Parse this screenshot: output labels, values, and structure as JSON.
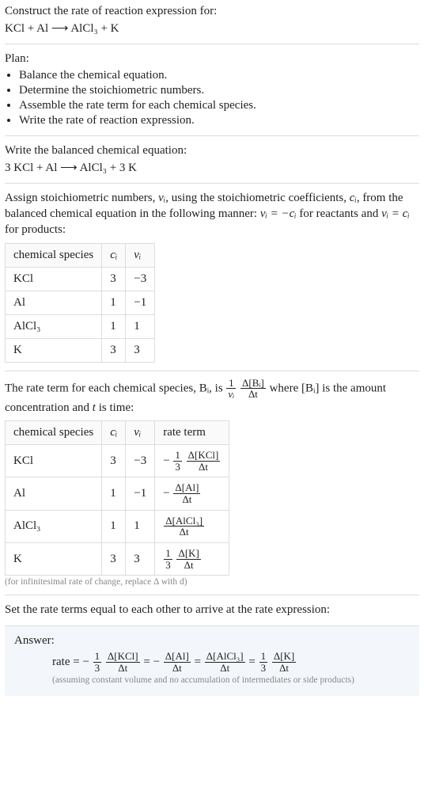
{
  "prompt": {
    "line1": "Construct the rate of reaction expression for:",
    "eq_unbalanced": "KCl + Al ⟶ AlCl₃ + K"
  },
  "plan": {
    "heading": "Plan:",
    "items": [
      "Balance the chemical equation.",
      "Determine the stoichiometric numbers.",
      "Assemble the rate term for each chemical species.",
      "Write the rate of reaction expression."
    ]
  },
  "balanced": {
    "heading": "Write the balanced chemical equation:",
    "eq": "3 KCl + Al ⟶ AlCl₃ + 3 K"
  },
  "stoich": {
    "intro_a": "Assign stoichiometric numbers, ",
    "sym_nu_i": "νᵢ",
    "intro_b": ", using the stoichiometric coefficients, ",
    "sym_c_i": "cᵢ",
    "intro_c": ", from the balanced chemical equation in the following manner: ",
    "rule_react": "νᵢ = −cᵢ",
    "intro_d": " for reactants and ",
    "rule_prod": "νᵢ = cᵢ",
    "intro_e": " for products:",
    "table": {
      "headers": [
        "chemical species",
        "cᵢ",
        "νᵢ"
      ],
      "rows": [
        {
          "species": "KCl",
          "c": "3",
          "nu": "−3"
        },
        {
          "species": "Al",
          "c": "1",
          "nu": "−1"
        },
        {
          "species": "AlCl₃",
          "c": "1",
          "nu": "1"
        },
        {
          "species": "K",
          "c": "3",
          "nu": "3"
        }
      ]
    }
  },
  "rateterm": {
    "intro_a": "The rate term for each chemical species, ",
    "sym_Bi": "Bᵢ",
    "intro_b": ", is ",
    "frac1_top": "1",
    "frac1_bot": "νᵢ",
    "frac2_top": "Δ[Bᵢ]",
    "frac2_bot": "Δt",
    "intro_c": " where ",
    "conc_label": "[Bᵢ]",
    "intro_d": " is the amount concentration and ",
    "sym_t": "t",
    "intro_e": " is time:",
    "table": {
      "headers": [
        "chemical species",
        "cᵢ",
        "νᵢ",
        "rate term"
      ],
      "rows": [
        {
          "species": "KCl",
          "c": "3",
          "nu": "−3",
          "coef_top": "1",
          "coef_bot": "3",
          "d_top": "Δ[KCl]",
          "d_bot": "Δt",
          "neg": true
        },
        {
          "species": "Al",
          "c": "1",
          "nu": "−1",
          "coef_top": "",
          "coef_bot": "",
          "d_top": "Δ[Al]",
          "d_bot": "Δt",
          "neg": true
        },
        {
          "species": "AlCl₃",
          "c": "1",
          "nu": "1",
          "coef_top": "",
          "coef_bot": "",
          "d_top": "Δ[AlCl₃]",
          "d_bot": "Δt",
          "neg": false
        },
        {
          "species": "K",
          "c": "3",
          "nu": "3",
          "coef_top": "1",
          "coef_bot": "3",
          "d_top": "Δ[K]",
          "d_bot": "Δt",
          "neg": false
        }
      ]
    },
    "footnote": "(for infinitesimal rate of change, replace Δ with d)"
  },
  "final": {
    "heading": "Set the rate terms equal to each other to arrive at the rate expression:"
  },
  "answer": {
    "label": "Answer:",
    "lhs": "rate = ",
    "terms": [
      {
        "neg": true,
        "coef_top": "1",
        "coef_bot": "3",
        "d_top": "Δ[KCl]",
        "d_bot": "Δt"
      },
      {
        "neg": true,
        "coef_top": "",
        "coef_bot": "",
        "d_top": "Δ[Al]",
        "d_bot": "Δt"
      },
      {
        "neg": false,
        "coef_top": "",
        "coef_bot": "",
        "d_top": "Δ[AlCl₃]",
        "d_bot": "Δt"
      },
      {
        "neg": false,
        "coef_top": "1",
        "coef_bot": "3",
        "d_top": "Δ[K]",
        "d_bot": "Δt"
      }
    ],
    "sep": " = ",
    "subnote": "(assuming constant volume and no accumulation of intermediates or side products)"
  },
  "chart_data": {
    "type": "table",
    "tables": [
      {
        "title": "Stoichiometric numbers",
        "columns": [
          "chemical species",
          "c_i",
          "nu_i"
        ],
        "rows": [
          [
            "KCl",
            3,
            -3
          ],
          [
            "Al",
            1,
            -1
          ],
          [
            "AlCl3",
            1,
            1
          ],
          [
            "K",
            3,
            3
          ]
        ]
      },
      {
        "title": "Rate terms",
        "columns": [
          "chemical species",
          "c_i",
          "nu_i",
          "rate term"
        ],
        "rows": [
          [
            "KCl",
            3,
            -3,
            "-(1/3) d[KCl]/dt"
          ],
          [
            "Al",
            1,
            -1,
            "- d[Al]/dt"
          ],
          [
            "AlCl3",
            1,
            1,
            "d[AlCl3]/dt"
          ],
          [
            "K",
            3,
            3,
            "(1/3) d[K]/dt"
          ]
        ]
      }
    ]
  }
}
